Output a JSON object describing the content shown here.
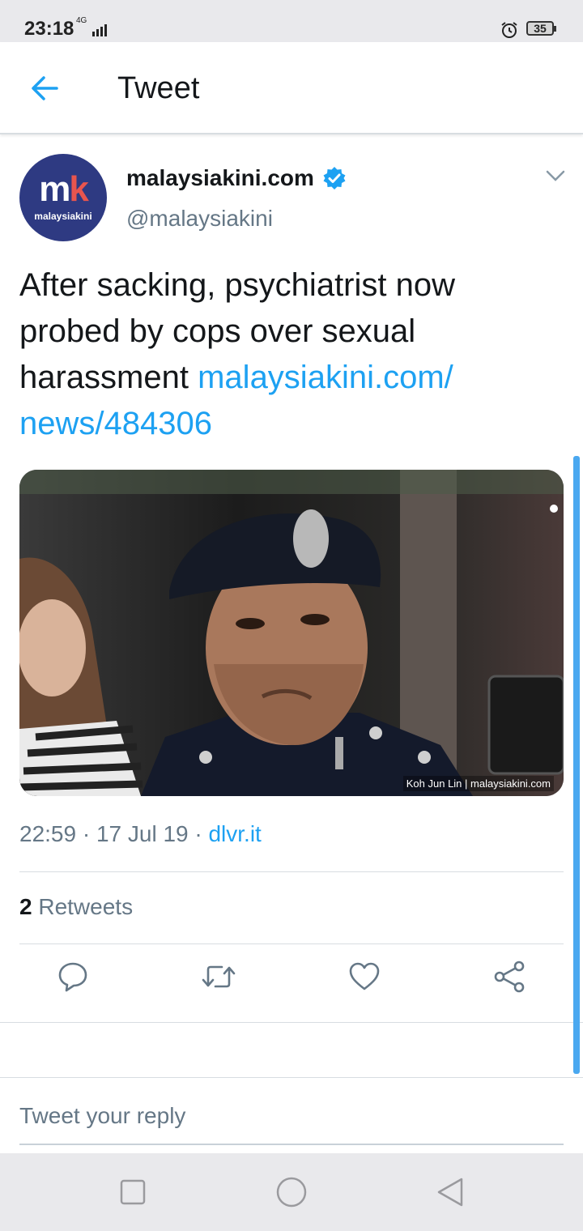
{
  "status_bar": {
    "time": "23:18",
    "network": "4G",
    "battery": "35"
  },
  "header": {
    "title": "Tweet"
  },
  "tweet": {
    "display_name": "malaysiakini.com",
    "handle": "@malaysiakini",
    "avatar_mark_m": "m",
    "avatar_mark_k": "k",
    "avatar_text": "malaysiakini",
    "text": "After sacking, psychiatrist now probed by cops over sexual harassment ",
    "link": "malaysiakini.com/ news/484306",
    "image_credit": "Koh Jun Lin | malaysiakini.com",
    "timestamp": "22:59 · 17 Jul 19 · ",
    "source": "dlvr.it",
    "retweet_count": "2",
    "retweet_label": " Retweets"
  },
  "reply": {
    "placeholder": "Tweet your reply"
  },
  "icons": {
    "back": "arrow-left-icon",
    "verified": "verified-badge-icon",
    "caret": "chevron-down-icon",
    "reply": "comment-icon",
    "retweet": "retweet-icon",
    "like": "heart-icon",
    "share": "share-icon"
  },
  "colors": {
    "accent": "#1da1f2",
    "muted": "#657786",
    "avatar_bg": "#2e3a82"
  }
}
